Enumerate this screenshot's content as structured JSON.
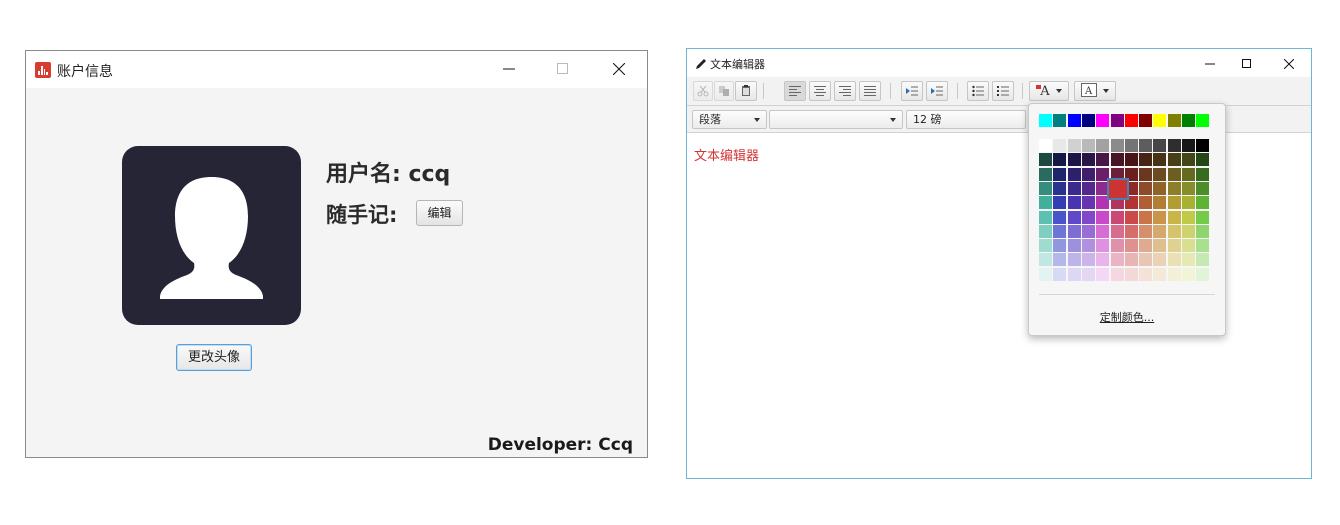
{
  "account_window": {
    "title": "账户信息",
    "username": "用户名: ccq",
    "note_label": "随手记:",
    "edit_label": "编辑",
    "change_avatar_label": "更改头像",
    "developer": "Developer: Ccq",
    "icon": "chart-app-icon",
    "window_icons": [
      "minimize-icon",
      "maximize-icon",
      "close-icon"
    ]
  },
  "editor_window": {
    "title": "文本编辑器",
    "icon": "pencil-icon",
    "toolbar_icons": [
      "cut-icon",
      "copy-icon",
      "paste-icon",
      "align-left-icon",
      "align-center-icon",
      "align-right-icon",
      "align-justify-icon",
      "outdent-icon",
      "indent-icon",
      "bullet-list-icon",
      "numbered-list-icon",
      "text-color-icon",
      "background-color-icon"
    ],
    "text_color_label": "A",
    "paragraph_select": "段落",
    "font_select": "",
    "size_select": "12 磅",
    "content": "文本编辑器",
    "content_color": "#d43636"
  },
  "color_popup": {
    "custom_label": "定制颜色...",
    "selected": "#cc3333",
    "top_row": [
      "#00ffff",
      "#008080",
      "#0000ff",
      "#000080",
      "#ff00ff",
      "#800080",
      "#ff0000",
      "#800000",
      "#ffff00",
      "#808000",
      "#008000",
      "#00ff00"
    ]
  }
}
